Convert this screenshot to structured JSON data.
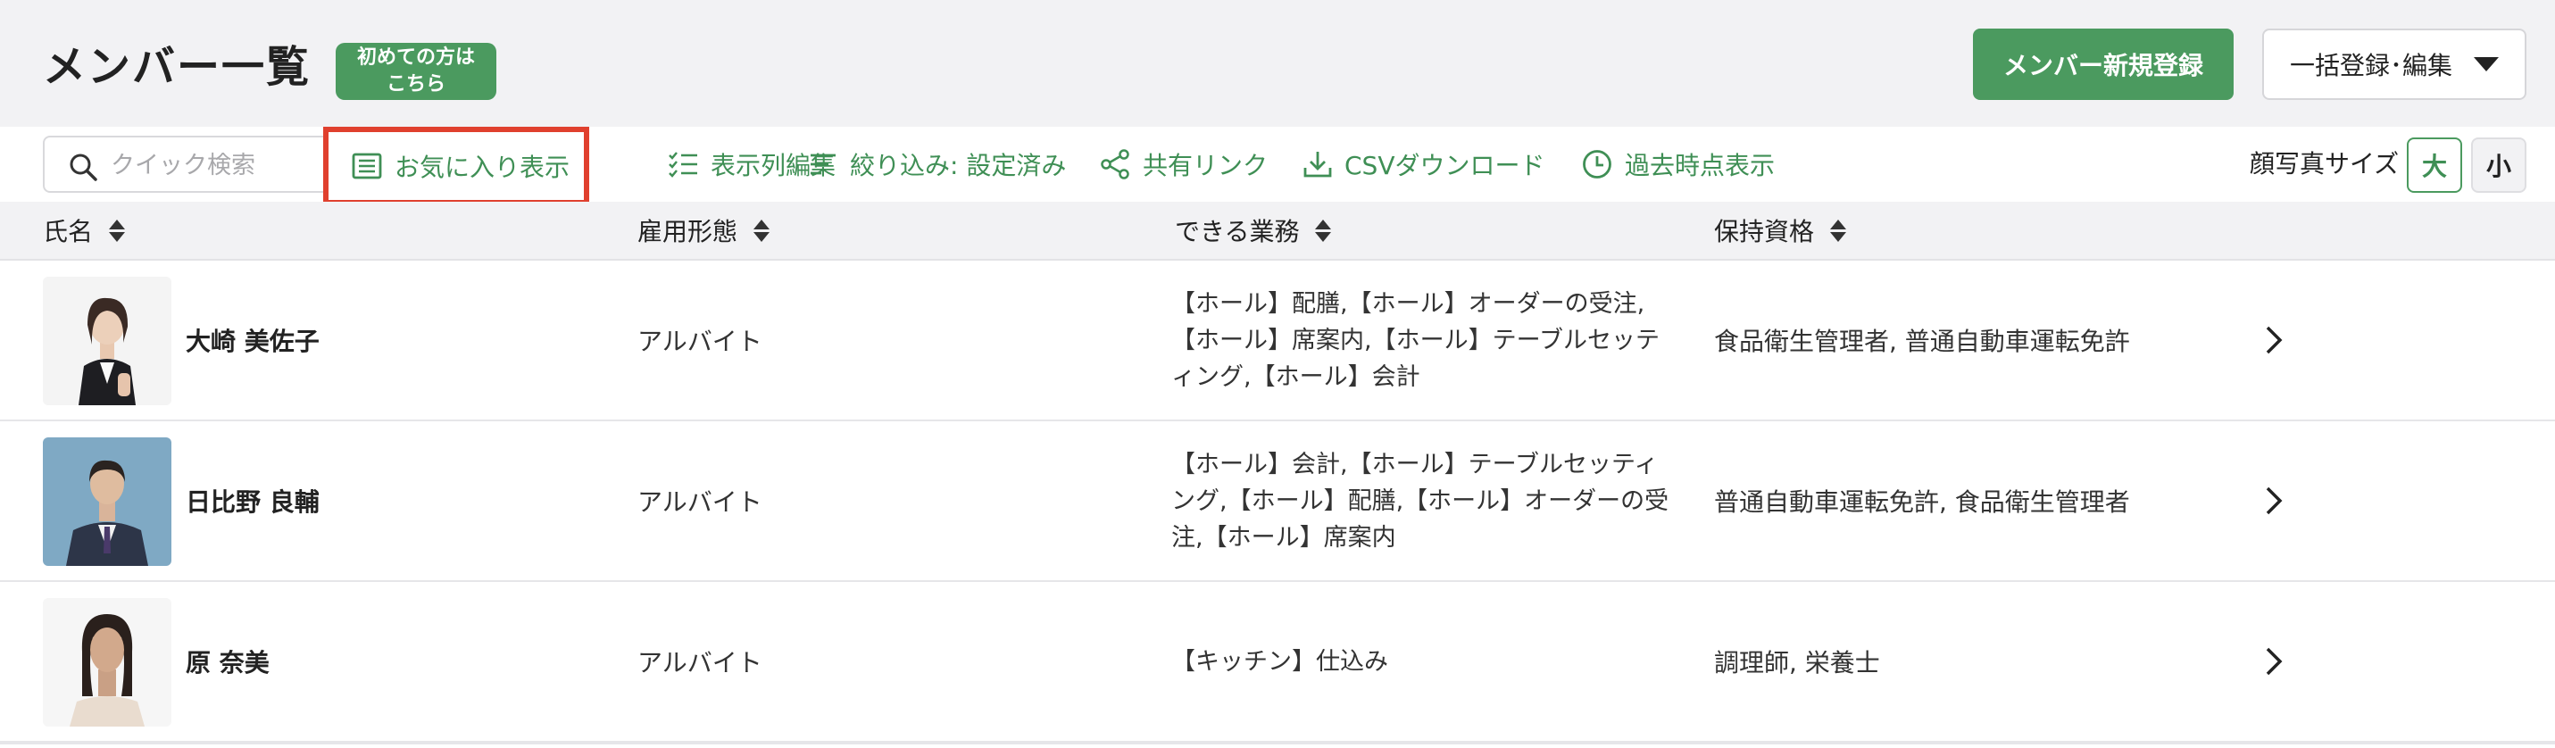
{
  "header": {
    "title": "メンバー一覧",
    "guide_badge_line1": "初めての方は",
    "guide_badge_line2": "こちら",
    "register_button": "メンバー新規登録",
    "bulk_button": "一括登録･編集"
  },
  "toolbar": {
    "search_placeholder": "クイック検索",
    "favorites": "お気に入り表示",
    "columns": "表示列編集",
    "filter": "絞り込み: 設定済み",
    "share": "共有リンク",
    "csv": "CSVダウンロード",
    "history": "過去時点表示",
    "photo_size_label": "顔写真サイズ",
    "size_large": "大",
    "size_small": "小"
  },
  "colors": {
    "accent": "#4b9a5f",
    "highlight": "#e0402e"
  },
  "table": {
    "headers": {
      "name": "氏名",
      "employment": "雇用形態",
      "tasks": "できる業務",
      "qualifications": "保持資格"
    },
    "rows": [
      {
        "name": "大崎 美佐子",
        "employment": "アルバイト",
        "tasks": "【ホール】配膳,【ホール】オーダーの受注,【ホール】席案内,【ホール】テーブルセッティング,【ホール】会計",
        "qualifications": "食品衛生管理者, 普通自動車運転免許"
      },
      {
        "name": "日比野 良輔",
        "employment": "アルバイト",
        "tasks": "【ホール】会計,【ホール】テーブルセッティング,【ホール】配膳,【ホール】オーダーの受注,【ホール】席案内",
        "qualifications": "普通自動車運転免許, 食品衛生管理者"
      },
      {
        "name": "原 奈美",
        "employment": "アルバイト",
        "tasks": "【キッチン】仕込み",
        "qualifications": "調理師, 栄養士"
      }
    ]
  }
}
